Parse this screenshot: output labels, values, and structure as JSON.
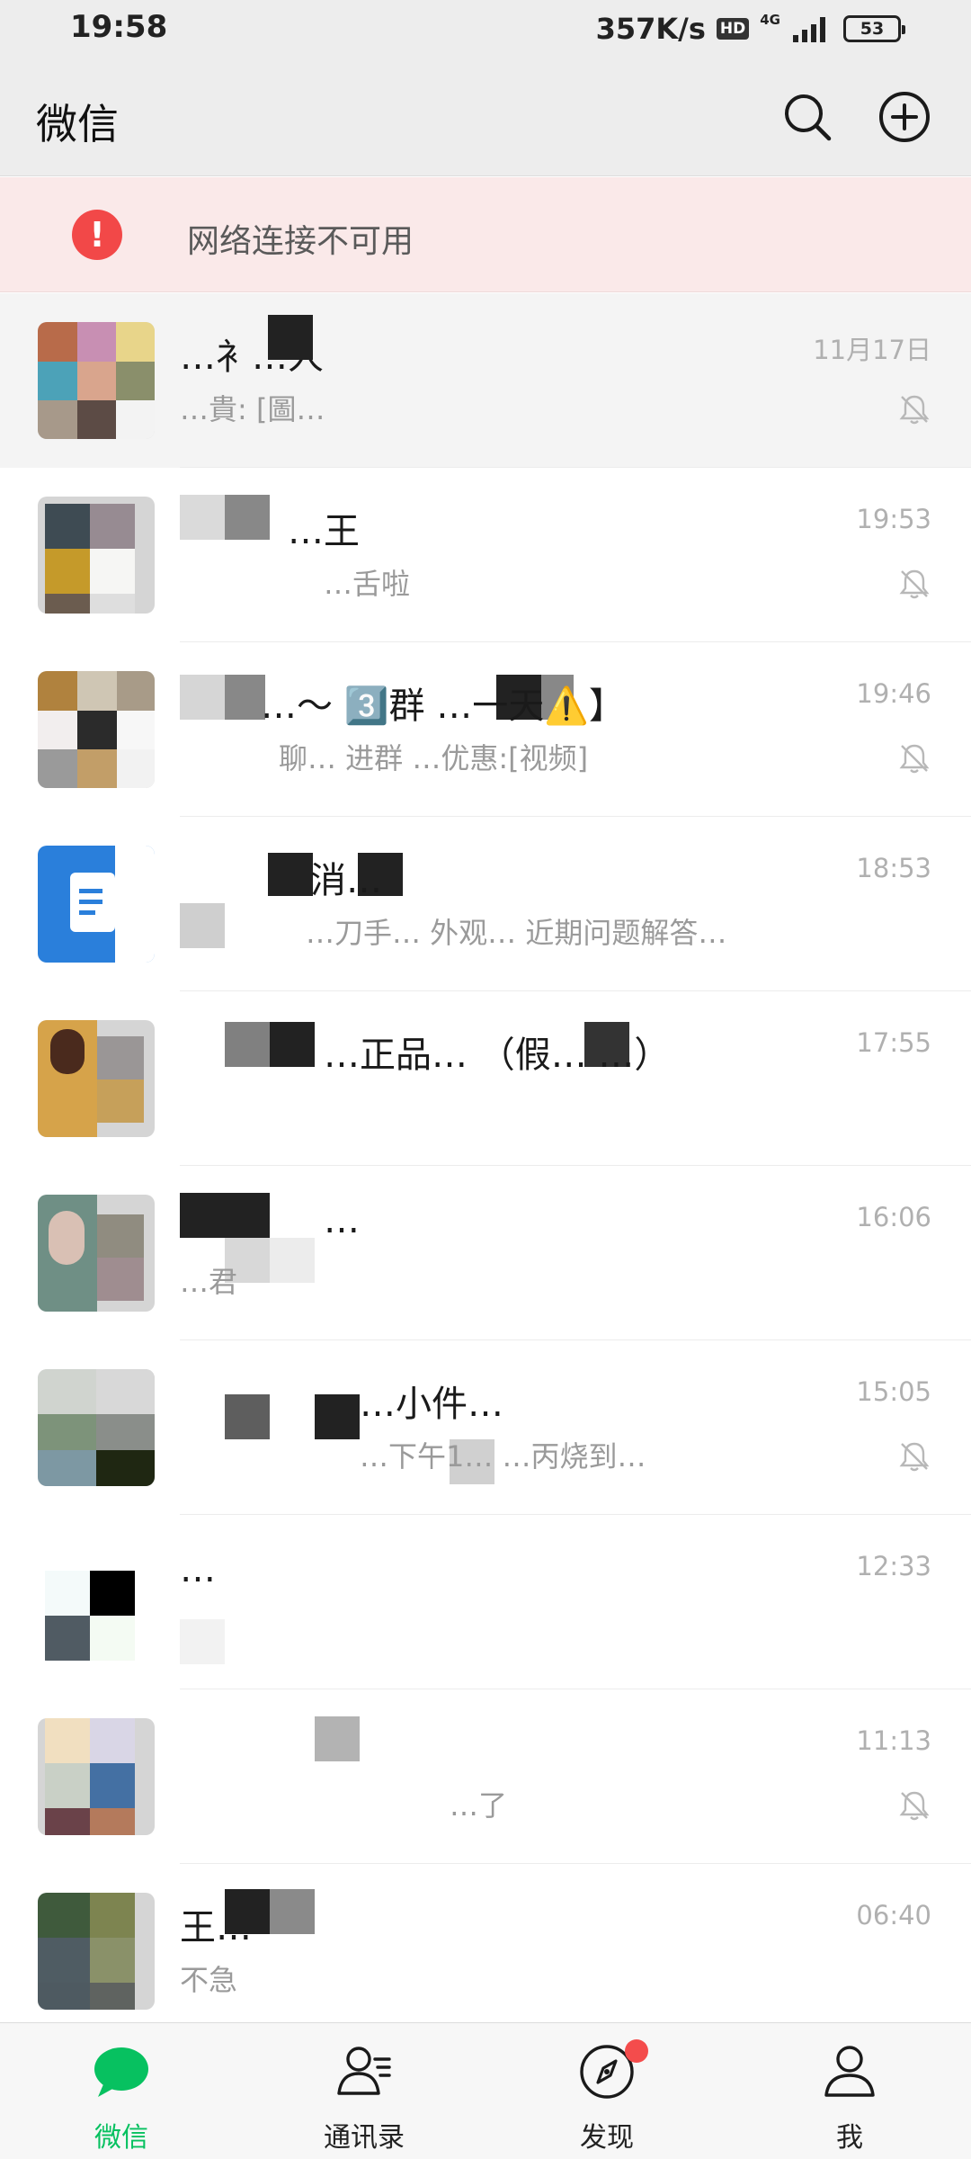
{
  "status_bar": {
    "time": "19:58",
    "net_speed": "357K/s",
    "hd": "HD",
    "network": "4G",
    "battery": "53"
  },
  "header": {
    "title": "微信",
    "search_icon": "search-icon",
    "add_icon": "plus-circle-icon"
  },
  "banner": {
    "text": "网络连接不可用",
    "icon": "warning-icon",
    "color": "#f24848"
  },
  "chats": [
    {
      "name": "…衤…人",
      "message": "…貴: [圖…",
      "time": "11月17日",
      "muted": true,
      "pinned": true
    },
    {
      "name": "…王",
      "message": "…舌啦",
      "time": "19:53",
      "muted": true
    },
    {
      "name": "…～ 3️⃣群 …一天⚠️】",
      "message": "聊… 进群 …优惠:[视频]",
      "time": "19:46",
      "muted": true
    },
    {
      "name": "消…",
      "message": "…刀手… 外观… 近期问题解答…",
      "time": "18:53",
      "muted": false
    },
    {
      "name": "…正品… （假… …）",
      "message": "",
      "time": "17:55",
      "muted": false
    },
    {
      "name": "…",
      "message": "…君",
      "time": "16:06",
      "muted": false
    },
    {
      "name": "…小件…",
      "message": "…下午1… …丙烧到…",
      "time": "15:05",
      "muted": true
    },
    {
      "name": "…",
      "message": "",
      "time": "12:33",
      "muted": false
    },
    {
      "name": "",
      "message": "…了",
      "time": "11:13",
      "muted": true
    },
    {
      "name": "王…",
      "message": "不急",
      "time": "06:40",
      "muted": false
    }
  ],
  "tabs": [
    {
      "label": "微信",
      "icon": "chat-bubble-icon",
      "active": true
    },
    {
      "label": "通讯录",
      "icon": "contacts-icon",
      "active": false
    },
    {
      "label": "发现",
      "icon": "compass-icon",
      "active": false,
      "badge_dot": true
    },
    {
      "label": "我",
      "icon": "person-icon",
      "active": false
    }
  ],
  "colors": {
    "accent": "#07c160",
    "badge": "#f44c4c",
    "background": "#ededed"
  }
}
